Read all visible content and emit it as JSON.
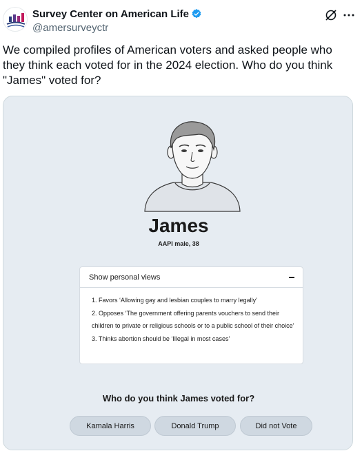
{
  "author": {
    "name": "Survey Center on American Life",
    "handle": "@amersurveyctr"
  },
  "tweet": {
    "text": "We compiled profiles of American voters and asked people who they think each voted for in the 2024 election. Who do you think \"James\" voted for?"
  },
  "card": {
    "name": "James",
    "subtitle": "AAPI male, 38",
    "views_title": "Show personal views",
    "views": [
      "1. Favors ‘Allowing gay and lesbian couples to marry legally’",
      "2. Opposes ‘The government offering parents vouchers to send their children to private or religious schools or to a public school of their choice’",
      "3. Thinks abortion should be ‘Illegal in most cases’"
    ],
    "question": "Who do you think James voted for?",
    "options": [
      "Kamala Harris",
      "Donald Trump",
      "Did not Vote"
    ]
  },
  "colors": {
    "card_background": "#e6ecf2",
    "button_background": "#cfd8e1",
    "verified": "#1d9bf0",
    "logo_bars": [
      "#2c3e7a",
      "#9b2c7a",
      "#c2185b"
    ]
  }
}
